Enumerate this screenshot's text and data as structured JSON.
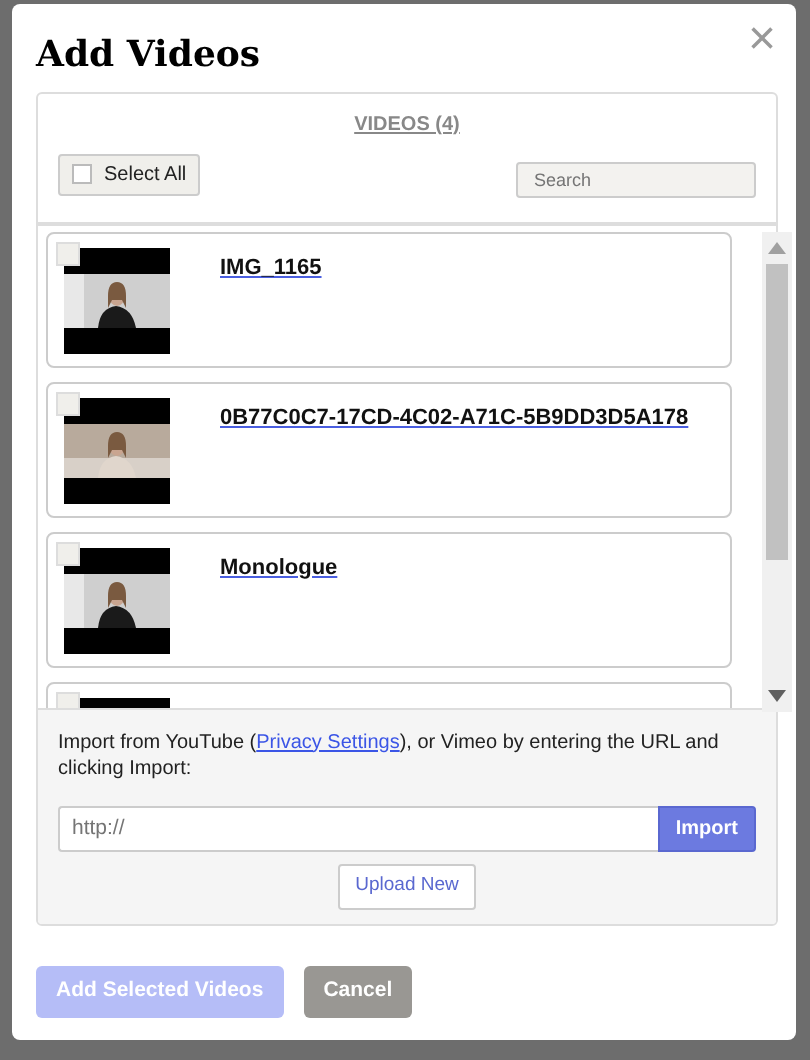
{
  "dialog": {
    "title": "Add Videos",
    "close": "×"
  },
  "videos_panel": {
    "heading": "VIDEOS (4)",
    "select_all": {
      "label": "Select All",
      "checked": false
    },
    "search": {
      "placeholder": "Search"
    },
    "videos": [
      {
        "title": "IMG_1165",
        "checked": false
      },
      {
        "title": "0B77C0C7-17CD-4C02-A71C-5B9DD3D5A178",
        "checked": false
      },
      {
        "title": "Monologue",
        "checked": false
      },
      {
        "checked": false
      }
    ]
  },
  "import": {
    "text": "Import from YouTube (",
    "link": "Privacy Settings",
    "text_after": "), or Vimeo by entering the URL and clicking Import:",
    "url": {
      "placeholder": "http://"
    },
    "import_button": "Import",
    "upload_button": "Upload New"
  },
  "footer": {
    "add_button": {
      "label": "Add Selected Videos",
      "disabled": true
    },
    "cancel_button": "Cancel"
  }
}
